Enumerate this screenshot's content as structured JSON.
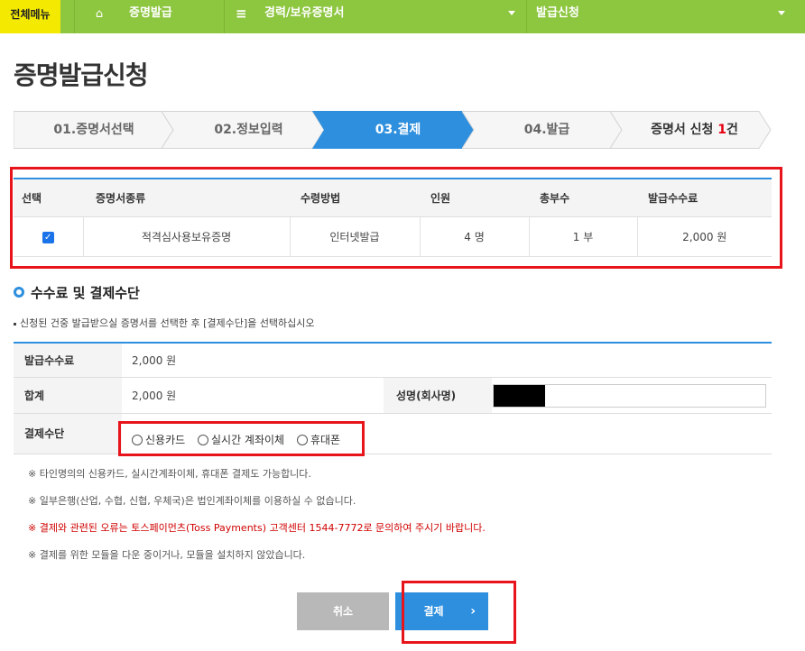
{
  "topnav": {
    "allmenu": "전체메뉴",
    "home_icon": "home-icon",
    "item1": "증명발급",
    "item2": "경력/보유증명서",
    "item3": "발급신청",
    "menu_icon": "hamburger-icon",
    "colors": {
      "bar": "#8dc63f",
      "allmenu": "#f4e900"
    }
  },
  "page_title": "증명발급신청",
  "steps": {
    "s1": "01.증명서선택",
    "s2": "02.정보입력",
    "s3": "03.결제",
    "s4": "04.발급",
    "s5_prefix": "증명서 신청 ",
    "s5_count": "1",
    "s5_suffix": "건",
    "active_color": "#2d8fde"
  },
  "selection_table": {
    "headers": [
      "선택",
      "증명서종류",
      "수령방법",
      "인원",
      "총부수",
      "발급수수료"
    ],
    "row": {
      "checked": "✓",
      "type": "적격심사용보유증명",
      "method": "인터넷발급",
      "people": "4 명",
      "copies": "1 부",
      "fee": "2,000 원"
    }
  },
  "section": {
    "title": "수수료 및 결제수단",
    "desc": "신청된 건중 발급받으실 증명서를 선택한 후 [결제수단]을 선택하십시오"
  },
  "fee_table": {
    "fee_label": "발급수수료",
    "fee_value": "2,000 원",
    "total_label": "합계",
    "total_value": "2,000 원",
    "name_label": "성명(회사명)",
    "payment_label": "결제수단",
    "payment_options": [
      "신용카드",
      "실시간 계좌이체",
      "휴대폰"
    ]
  },
  "notes": [
    "※ 타인명의의 신용카드, 실시간계좌이체, 휴대폰 결제도 가능합니다.",
    "※ 일부은행(산업, 수협, 신협, 우체국)은 법인계좌이체를 이용하실 수 없습니다.",
    "※ 결제와 관련된 오류는 토스페이먼츠(Toss Payments) 고객센터 1544-7772로 문의하여 주시기 바랍니다.",
    "※ 결제를 위한 모듈을 다운 중이거나, 모듈을 설치하지 않았습니다."
  ],
  "buttons": {
    "cancel": "취소",
    "pay": "결제",
    "pay_icon": "chevron-right-icon"
  }
}
